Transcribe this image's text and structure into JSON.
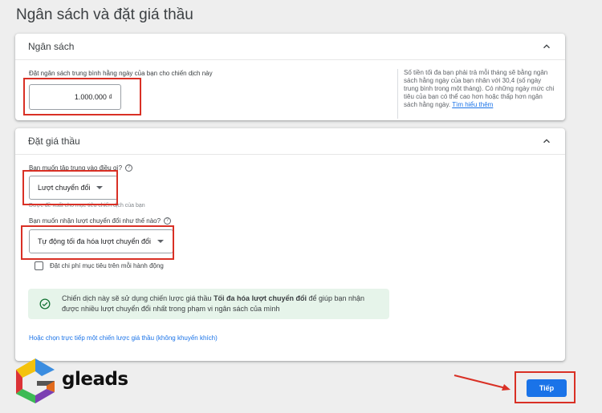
{
  "page": {
    "title": "Ngân sách và đặt giá thầu"
  },
  "budget_card": {
    "title": "Ngân sách",
    "field_label": "Đặt ngân sách trung bình hằng ngày của bạn cho chiến dịch này",
    "value": "1.000.000 ₫",
    "note": "Số tiền tối đa bạn phải trả mỗi tháng sẽ bằng ngân sách hằng ngày của bạn nhân với 30,4 (số ngày trung bình trong một tháng). Có những ngày mức chi tiêu của bạn có thể cao hơn hoặc thấp hơn ngân sách hằng ngày.",
    "note_link": "Tìm hiểu thêm"
  },
  "bidding_card": {
    "title": "Đặt giá thầu",
    "focus_question": "Bạn muốn tập trung vào điều gì?",
    "focus_value": "Lượt chuyển đổi",
    "focus_hint": "Được đề xuất cho mục tiêu chiến dịch của bạn",
    "conversion_question": "Bạn muốn nhận lượt chuyển đổi như thế nào?",
    "conversion_value": "Tự động tối đa hóa lượt chuyển đổi",
    "cpa_checkbox_label": "Đặt chi phí mục tiêu trên mỗi hành động",
    "info_prefix": "Chiến dịch này sẽ sử dụng chiến lược giá thầu ",
    "info_strategy": "Tối đa hóa lượt chuyển đổi",
    "info_suffix": " để giúp bạn nhận được nhiều lượt chuyển đổi nhất trong phạm vi ngân sách của mình",
    "direct_strategy_link": "Hoặc chọn trực tiếp một chiến lược giá thầu (không khuyến khích)"
  },
  "actions": {
    "next_label": "Tiếp"
  },
  "branding": {
    "logo_text": "gleads"
  },
  "colors": {
    "accent": "#1a73e8",
    "highlight": "#d93025",
    "info_bg": "#e6f4ea",
    "success": "#137333"
  },
  "icons": {
    "collapse": "chevron-up-icon",
    "help": "help-circle-icon",
    "dropdown": "caret-down-icon",
    "success": "check-circle-icon"
  }
}
